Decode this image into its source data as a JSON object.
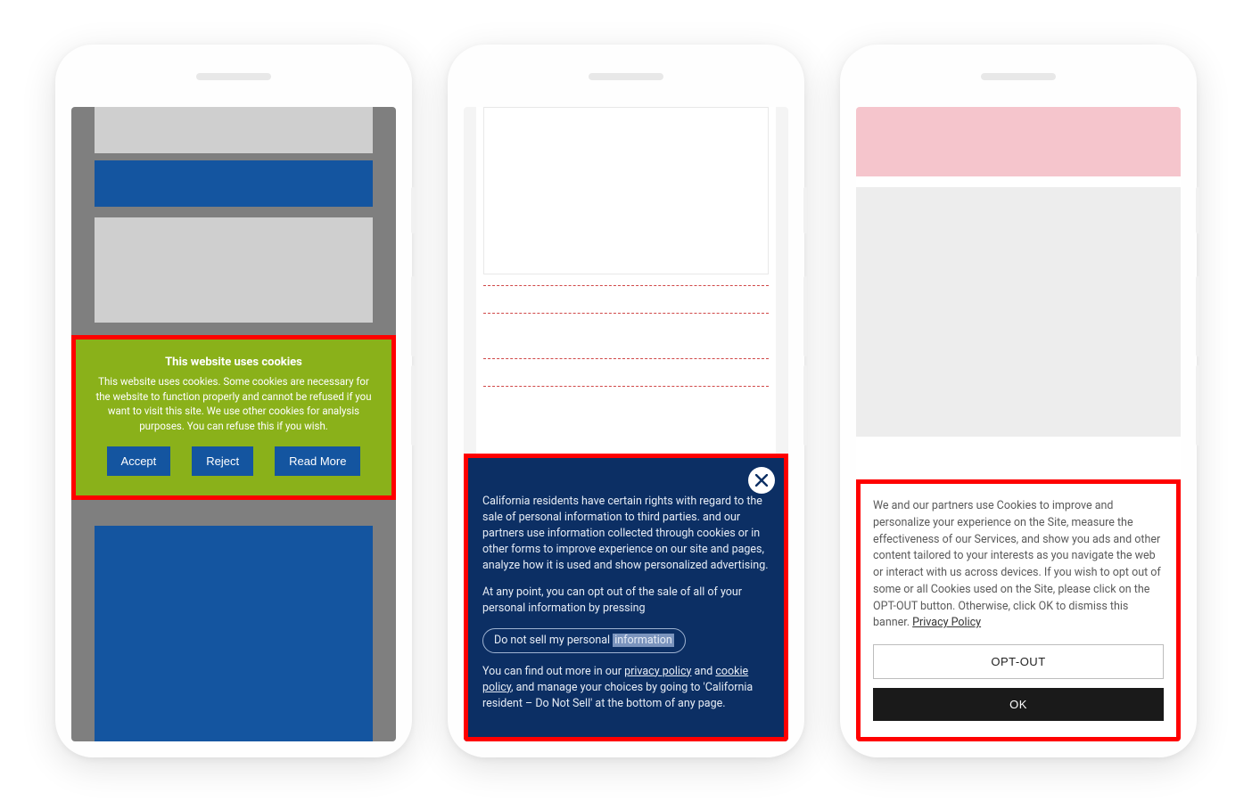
{
  "phone1": {
    "cookie": {
      "title": "This website uses cookies",
      "body": "This website uses cookies. Some cookies are necessary for the website to function properly and cannot be refused if you want to visit this site. We use other cookies for analysis purposes. You can refuse this if you wish.",
      "accept": "Accept",
      "reject": "Reject",
      "read_more": "Read More"
    }
  },
  "phone2": {
    "cookie": {
      "para1_a": "California residents have certain rights with regard to the sale of personal information to third parties.",
      "para1_b": " and our partners use information collected through cookies or in other forms to improve experience on our site and pages, analyze how it is used and show personalized advertising.",
      "para2": "At any point, you can opt out of the sale of all of your personal information by pressing",
      "dont_sell_prefix": "Do not sell my personal ",
      "dont_sell_hl": "information",
      "para3_a": "You can find out more in our ",
      "privacy_policy": "privacy policy",
      "para3_b": " and ",
      "cookie_policy": "cookie policy",
      "para3_c": ", and manage your choices by going to 'California resident – Do Not Sell' at the bottom of any page."
    }
  },
  "phone3": {
    "cookie": {
      "body_a": "We and our partners use Cookies to improve and personalize your experience on the Site, measure the effectiveness of our Services, and show you ads and other content tailored to your interests as you navigate the web or interact with us across devices. If you wish to opt out of some or all Cookies used on the Site, please click on the OPT-OUT button. Otherwise, click OK to dismiss this banner. ",
      "privacy_policy": "Privacy Policy",
      "opt_out": "OPT-OUT",
      "ok": "OK"
    }
  }
}
